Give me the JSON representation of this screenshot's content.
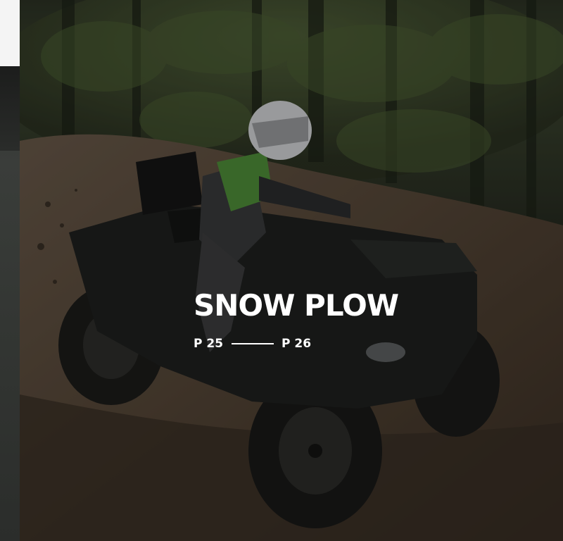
{
  "hero": {
    "image_alt": "Rider in green vest and white helmet driving a black ATV through muddy forest trail",
    "heading": "SNOW PLOW",
    "page_from": "P 25",
    "page_to": "P 26"
  },
  "colors": {
    "heading_text": "#ffffff",
    "overlay": "rgba(0,0,0,0.28)",
    "vest_green": "#4f8f3a",
    "left_strip_top": "#f4f4f4"
  },
  "icons": {
    "divider": "horizontal-line"
  }
}
